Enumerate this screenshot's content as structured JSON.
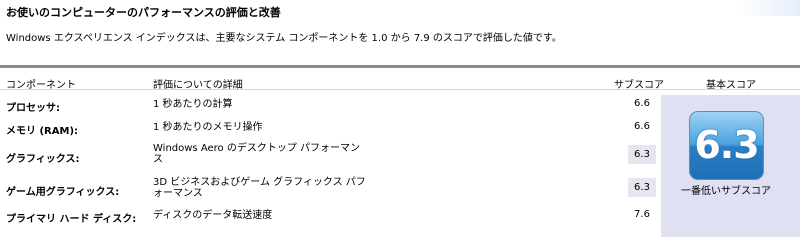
{
  "page": {
    "title": "お使いのコンピューターのパフォーマンスの評価と改善",
    "description": "Windows エクスペリエンス インデックスは、主要なシステム コンポーネントを 1.0 から 7.9 のスコアで評価した値です。"
  },
  "table": {
    "headers": {
      "component": "コンポーネント",
      "detail": "評価についての詳細",
      "subscore": "サブスコア",
      "base": "基本スコア"
    },
    "rows": [
      {
        "name": "プロセッサ:",
        "detail": "1 秒あたりの計算",
        "subscore": "6.6",
        "highlight": false
      },
      {
        "name": "メモリ (RAM):",
        "detail": "1 秒あたりのメモリ操作",
        "subscore": "6.6",
        "highlight": false
      },
      {
        "name": "グラフィックス:",
        "detail": "Windows Aero のデスクトップ パフォーマンス",
        "subscore": "6.3",
        "highlight": true
      },
      {
        "name": "ゲーム用グラフィックス:",
        "detail": "3D ビジネスおよびゲーム グラフィックス パフォーマンス",
        "subscore": "6.3",
        "highlight": true
      },
      {
        "name": "プライマリ ハード ディスク:",
        "detail": "ディスクのデータ転送速度",
        "subscore": "7.6",
        "highlight": false
      }
    ]
  },
  "base_score": {
    "value": "6.3",
    "label": "一番低いサブスコア"
  }
}
